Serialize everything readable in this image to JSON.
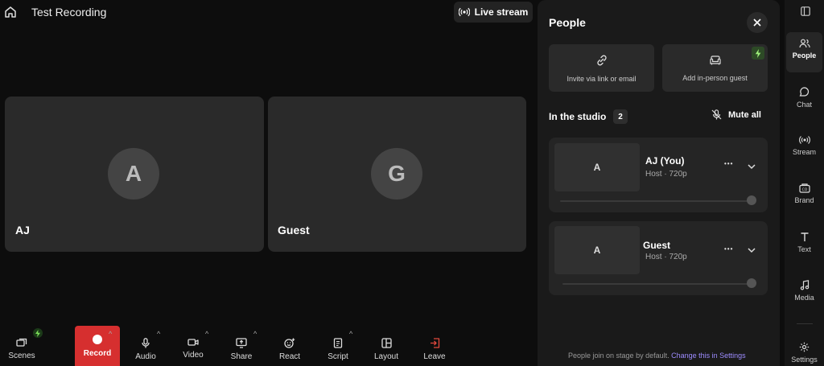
{
  "header": {
    "title": "Test Recording",
    "live_stream_label": "Live stream"
  },
  "stage": {
    "tiles": [
      {
        "initial": "A",
        "name": "AJ"
      },
      {
        "initial": "G",
        "name": "Guest"
      }
    ]
  },
  "toolbar": {
    "scenes": "Scenes",
    "record": "Record",
    "audio": "Audio",
    "video": "Video",
    "share": "Share",
    "react": "React",
    "script": "Script",
    "layout": "Layout",
    "leave": "Leave",
    "caret": "^"
  },
  "panel": {
    "title": "People",
    "invite_label": "Invite via link or email",
    "add_guest_label": "Add in-person guest",
    "studio_title": "In the studio",
    "studio_count": "2",
    "mute_all_label": "Mute all",
    "participants": [
      {
        "initial": "A",
        "name": "AJ (You)",
        "role": "Host · 720p",
        "volume": 1.0
      },
      {
        "initial": "A",
        "name": "Guest",
        "role": "Host · 720p",
        "volume": 1.0
      }
    ],
    "more_glyph": "•••",
    "footer_text": "People join on stage by default.",
    "footer_link": "Change this in Settings"
  },
  "rail": {
    "people": "People",
    "chat": "Chat",
    "stream": "Stream",
    "brand": "Brand",
    "text": "Text",
    "media": "Media",
    "settings": "Settings"
  },
  "colors": {
    "record": "#d62f2f",
    "accent_link": "#9d8cff",
    "bolt": "#7ee05a"
  }
}
